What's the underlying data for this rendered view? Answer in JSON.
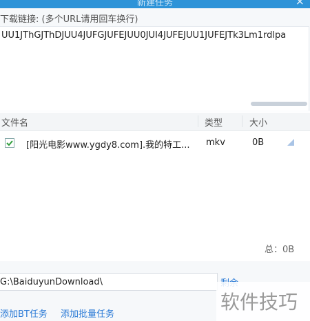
{
  "window": {
    "title": "新建任务",
    "close_glyph": "×"
  },
  "url_section": {
    "label": "下载链接: (多个URL请用回车换行)",
    "value": "UU1JThGJThDJUU4JUFGJUFEJUU0JUI4JUFEJUU1JUFEJTk3Lm1rdlpa"
  },
  "table": {
    "headers": {
      "name": "文件名",
      "type": "类型",
      "size": "大小"
    },
    "rows": [
      {
        "checked": true,
        "name": "[阳光电影www.ygdy8.com].我的特工...",
        "type": "mkv",
        "size": "0B"
      }
    ],
    "total": "总：0B"
  },
  "save_path": {
    "value": "G:\\BaiduyunDownload\\",
    "space_label": "剩余"
  },
  "actions": {
    "add_bt": "添加BT任务",
    "add_batch": "添加批量任务"
  },
  "watermark": "软件技巧",
  "colors": {
    "titlebar": "#2d93d8",
    "link": "#2a7ad6",
    "check": "#2e9e3a"
  }
}
